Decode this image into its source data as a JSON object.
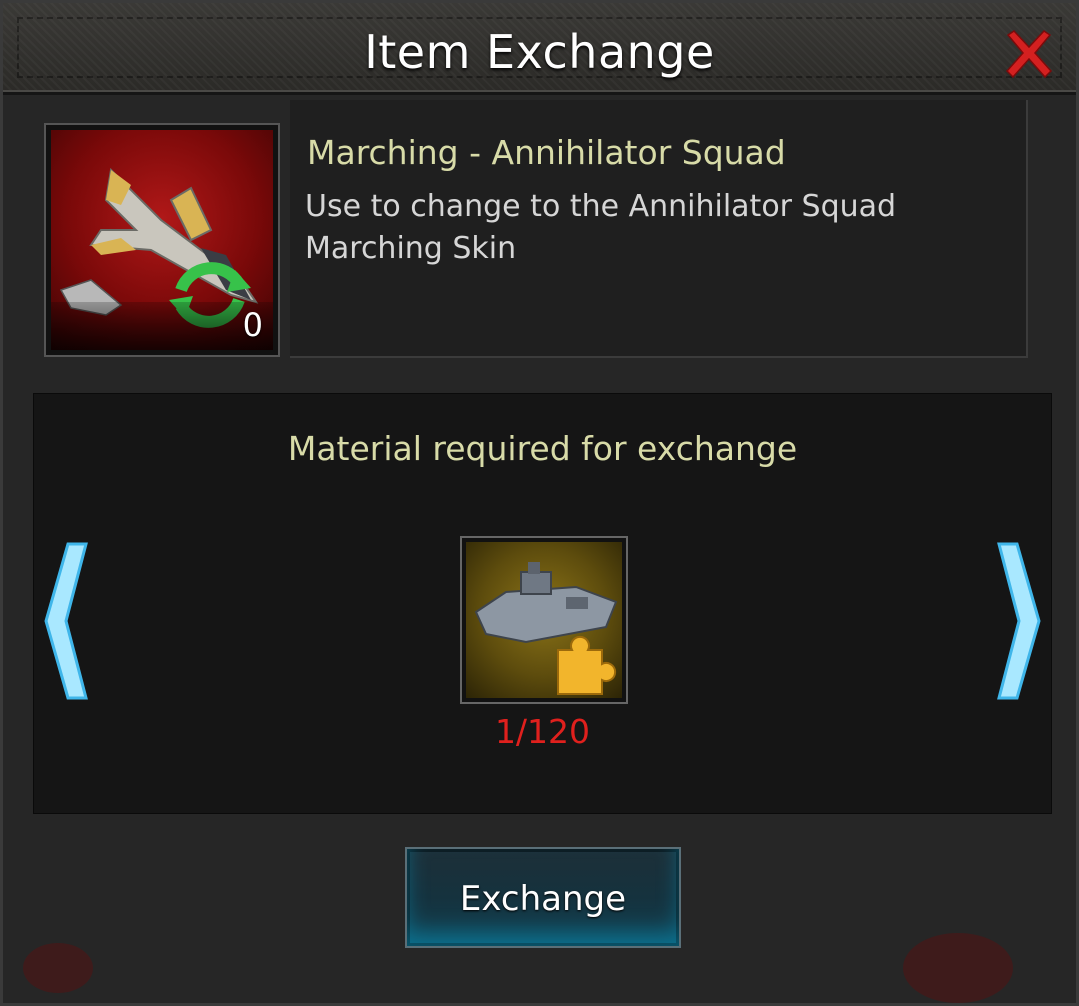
{
  "dialog": {
    "title": "Item Exchange",
    "close_icon": "close-x-icon"
  },
  "item": {
    "icon": "fighter-jet-skin-icon",
    "count": "0",
    "name": "Marching - Annihilator Squad",
    "description": "Use to change to the Annihilator Squad Marching Skin"
  },
  "material": {
    "heading": "Material required for exchange",
    "icon": "warship-puzzle-piece-icon",
    "progress": "1/120",
    "owned": 1,
    "required": 120
  },
  "navigation": {
    "prev_icon": "chevron-left-icon",
    "next_icon": "chevron-right-icon"
  },
  "actions": {
    "exchange_label": "Exchange"
  },
  "colors": {
    "title_text": "#ffffff",
    "accent_text": "#d8dba8",
    "progress_insufficient": "#e0201d",
    "arrow_glow": "#7fd8ff",
    "close_red": "#d42020"
  }
}
